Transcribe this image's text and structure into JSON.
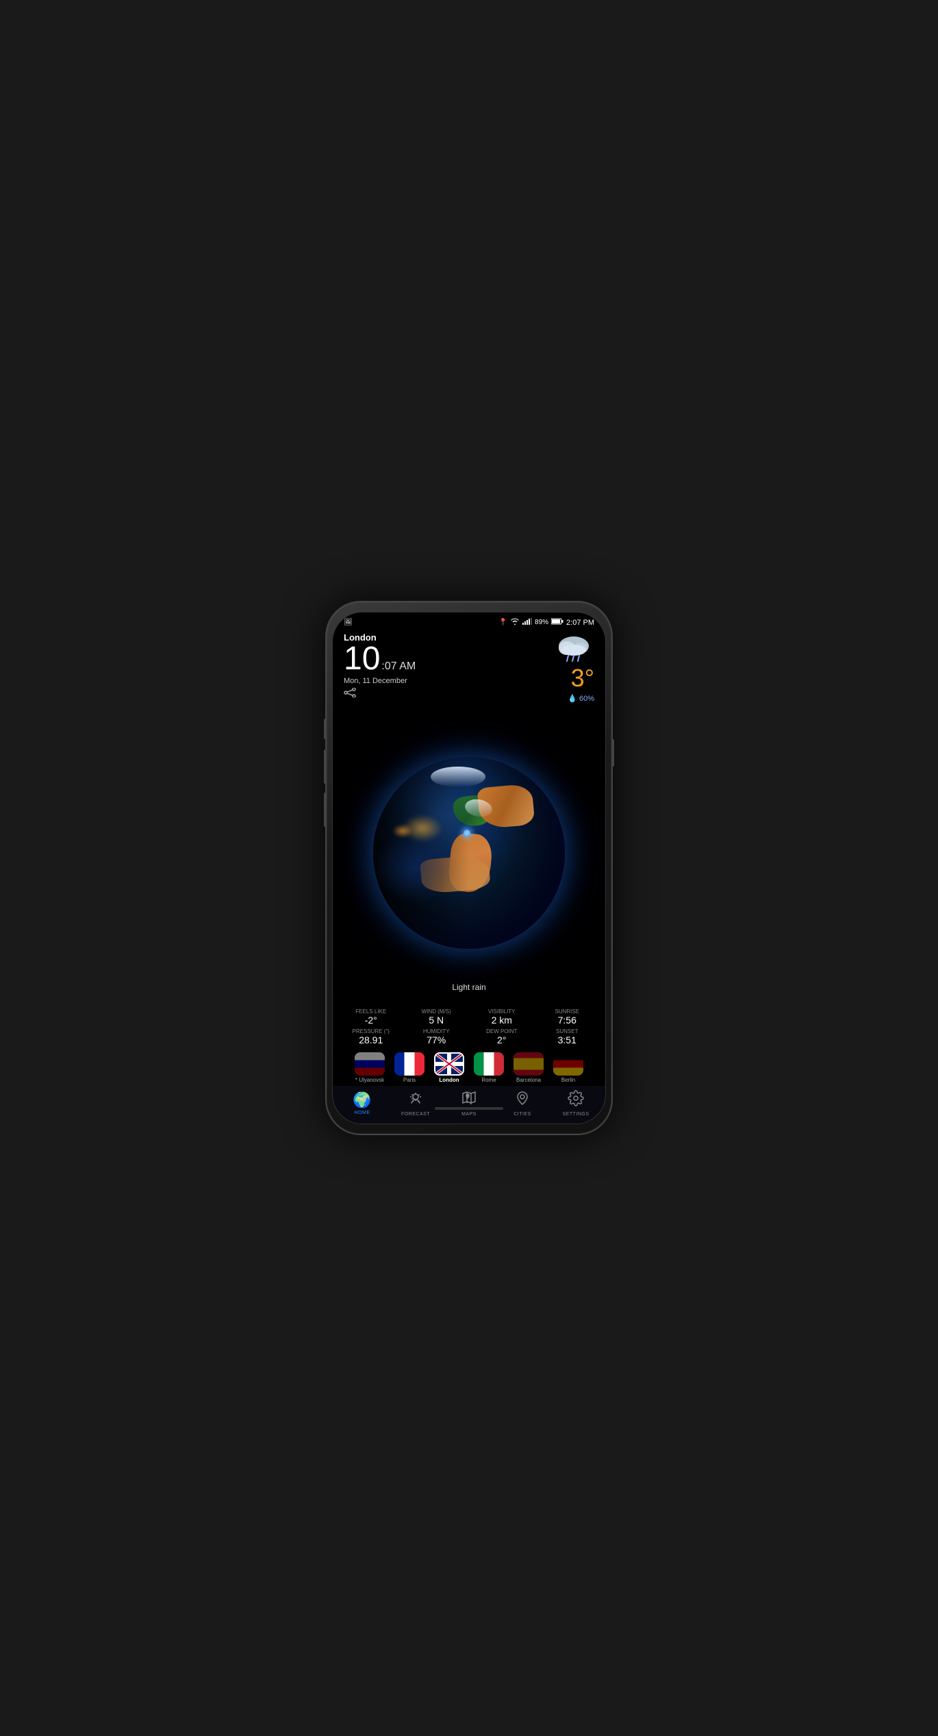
{
  "phone": {
    "status_bar": {
      "left_icon": "📷",
      "location_icon": "📍",
      "wifi_icon": "wifi",
      "signal_icon": "signal",
      "battery": "89%",
      "time": "2:07 PM"
    },
    "weather": {
      "city": "London",
      "time_hour": "10",
      "time_min_ampm": ":07 AM",
      "date": "Mon, 11 December",
      "condition": "Light rain",
      "temperature": "3°",
      "rain_chance": "💧 60%",
      "feels_like_label": "Feels like",
      "feels_like": "-2°",
      "wind_label": "Wind (m/s)",
      "wind": "5 N",
      "visibility_label": "Visibility",
      "visibility": "2 km",
      "sunrise_label": "Sunrise",
      "sunrise": "7:56",
      "pressure_label": "Pressure (\")",
      "pressure": "28.91",
      "humidity_label": "Humidity",
      "humidity": "77%",
      "dew_point_label": "Dew Point",
      "dew_point": "2°",
      "sunset_label": "Sunset",
      "sunset": "3:51"
    },
    "cities": [
      {
        "name": "* Ulyanovsk",
        "flag": "russia",
        "active": false
      },
      {
        "name": "Paris",
        "flag": "france",
        "active": false
      },
      {
        "name": "London",
        "flag": "uk",
        "active": true
      },
      {
        "name": "Rome",
        "flag": "italy",
        "active": false
      },
      {
        "name": "Barcelona",
        "flag": "spain",
        "active": false
      },
      {
        "name": "Berlin",
        "flag": "germany",
        "active": false
      }
    ],
    "nav": [
      {
        "id": "home",
        "label": "HOME",
        "icon": "🌍",
        "active": true
      },
      {
        "id": "forecast",
        "label": "FORECAST",
        "icon": "forecast",
        "active": false
      },
      {
        "id": "maps",
        "label": "MAPS",
        "icon": "maps",
        "active": false
      },
      {
        "id": "cities",
        "label": "CITIES",
        "icon": "cities",
        "active": false
      },
      {
        "id": "settings",
        "label": "SETTINGS",
        "icon": "settings",
        "active": false
      }
    ]
  }
}
